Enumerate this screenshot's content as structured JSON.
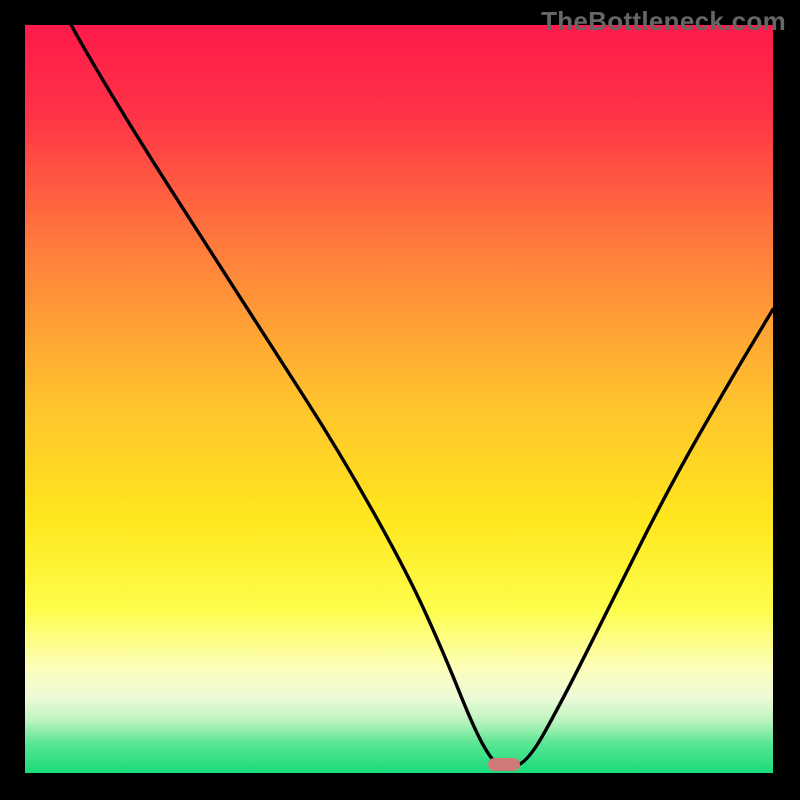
{
  "watermark": "TheBottleneck.com",
  "chart_data": {
    "type": "line",
    "title": "",
    "xlabel": "",
    "ylabel": "",
    "xlim": [
      0,
      100
    ],
    "ylim": [
      0,
      100
    ],
    "x": [
      0,
      6,
      15,
      24,
      33,
      42,
      51,
      56,
      60,
      62.5,
      64,
      67,
      72,
      78,
      86,
      94,
      100
    ],
    "values": [
      112,
      100,
      85,
      71,
      57,
      43,
      27,
      16,
      6,
      1.5,
      1,
      1,
      10,
      22,
      38,
      52,
      62
    ],
    "optimal_x": 64,
    "curve_stroke": "#000000",
    "curve_width": 3.4,
    "gradient_stops": [
      {
        "pct": 0,
        "color": "#ff1a4b"
      },
      {
        "pct": 12,
        "color": "#ff3347"
      },
      {
        "pct": 30,
        "color": "#ff7d3c"
      },
      {
        "pct": 50,
        "color": "#ffc22e"
      },
      {
        "pct": 66,
        "color": "#ffe71e"
      },
      {
        "pct": 78,
        "color": "#fdfd4a"
      },
      {
        "pct": 86,
        "color": "#fdfebb"
      },
      {
        "pct": 90,
        "color": "#ecfad8"
      },
      {
        "pct": 93,
        "color": "#bcf4bf"
      },
      {
        "pct": 96,
        "color": "#5be693"
      },
      {
        "pct": 100,
        "color": "#18db7b"
      }
    ],
    "marker": {
      "color": "#cf7a78",
      "w": 32,
      "h": 13
    }
  }
}
